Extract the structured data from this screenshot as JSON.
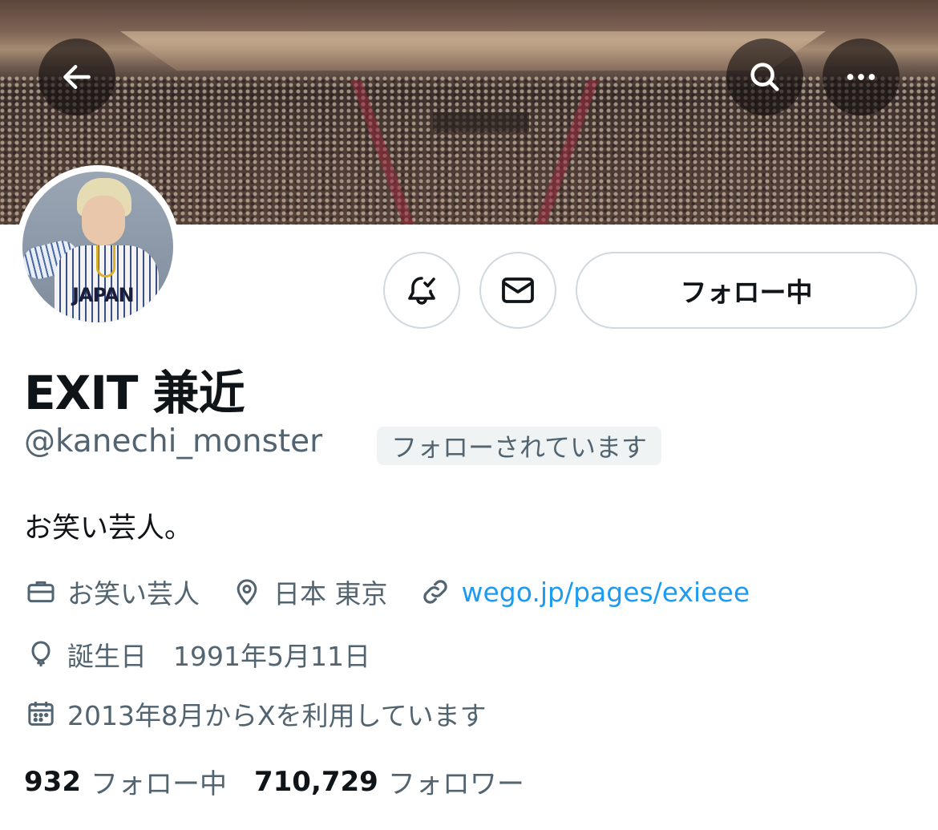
{
  "header": {
    "back_icon": "arrow-left-icon",
    "search_icon": "search-icon",
    "more_icon": "more-horizontal-icon"
  },
  "profile": {
    "display_name": "EXIT 兼近",
    "handle": "@kanechi_monster",
    "follows_you_badge": "フォローされています",
    "bio": "お笑い芸人。",
    "avatar_jersey_text": "JAPAN"
  },
  "actions": {
    "notify_icon": "bell-check-icon",
    "message_icon": "mail-icon",
    "follow_label": "フォロー中"
  },
  "meta": {
    "profession": "お笑い芸人",
    "location": "日本 東京",
    "website": "wego.jp/pages/exieee",
    "birthday": "誕生日　1991年5月11日",
    "joined": "2013年8月からXを利用しています"
  },
  "stats": {
    "following_count": "932",
    "following_label": "フォロー中",
    "followers_count": "710,729",
    "followers_label": "フォロワー"
  },
  "colors": {
    "text_primary": "#0f1419",
    "text_secondary": "#536471",
    "link": "#1d9bf0",
    "border": "#cfd9de",
    "badge_bg": "#eff3f4"
  }
}
